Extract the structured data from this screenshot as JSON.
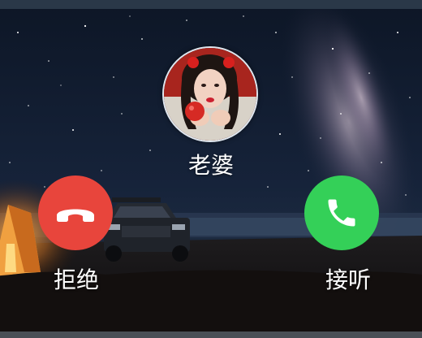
{
  "caller": {
    "name": "老婆",
    "avatar_icon": "contact-avatar-photo"
  },
  "actions": {
    "decline_label": "拒绝",
    "accept_label": "接听",
    "decline_icon": "phone-hangup-icon",
    "accept_icon": "phone-answer-icon",
    "decline_color": "#e8453c",
    "accept_color": "#34d058"
  }
}
